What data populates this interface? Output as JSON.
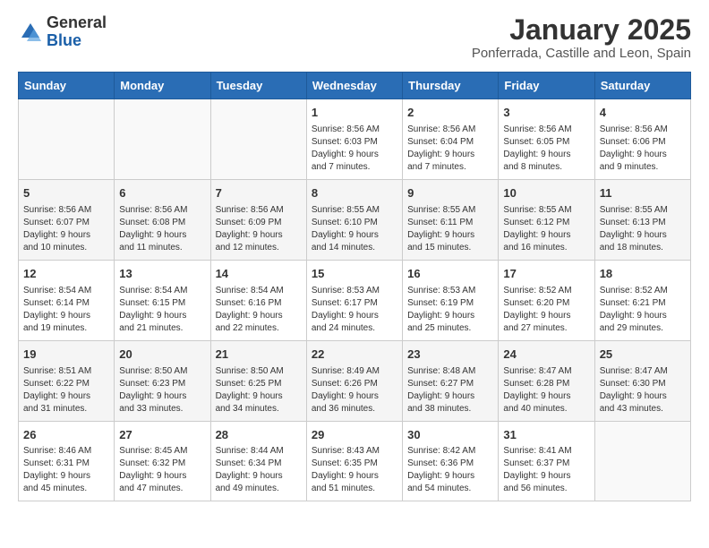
{
  "logo": {
    "general": "General",
    "blue": "Blue"
  },
  "title": "January 2025",
  "subtitle": "Ponferrada, Castille and Leon, Spain",
  "headers": [
    "Sunday",
    "Monday",
    "Tuesday",
    "Wednesday",
    "Thursday",
    "Friday",
    "Saturday"
  ],
  "weeks": [
    [
      {
        "day": "",
        "info": ""
      },
      {
        "day": "",
        "info": ""
      },
      {
        "day": "",
        "info": ""
      },
      {
        "day": "1",
        "info": "Sunrise: 8:56 AM\nSunset: 6:03 PM\nDaylight: 9 hours\nand 7 minutes."
      },
      {
        "day": "2",
        "info": "Sunrise: 8:56 AM\nSunset: 6:04 PM\nDaylight: 9 hours\nand 7 minutes."
      },
      {
        "day": "3",
        "info": "Sunrise: 8:56 AM\nSunset: 6:05 PM\nDaylight: 9 hours\nand 8 minutes."
      },
      {
        "day": "4",
        "info": "Sunrise: 8:56 AM\nSunset: 6:06 PM\nDaylight: 9 hours\nand 9 minutes."
      }
    ],
    [
      {
        "day": "5",
        "info": "Sunrise: 8:56 AM\nSunset: 6:07 PM\nDaylight: 9 hours\nand 10 minutes."
      },
      {
        "day": "6",
        "info": "Sunrise: 8:56 AM\nSunset: 6:08 PM\nDaylight: 9 hours\nand 11 minutes."
      },
      {
        "day": "7",
        "info": "Sunrise: 8:56 AM\nSunset: 6:09 PM\nDaylight: 9 hours\nand 12 minutes."
      },
      {
        "day": "8",
        "info": "Sunrise: 8:55 AM\nSunset: 6:10 PM\nDaylight: 9 hours\nand 14 minutes."
      },
      {
        "day": "9",
        "info": "Sunrise: 8:55 AM\nSunset: 6:11 PM\nDaylight: 9 hours\nand 15 minutes."
      },
      {
        "day": "10",
        "info": "Sunrise: 8:55 AM\nSunset: 6:12 PM\nDaylight: 9 hours\nand 16 minutes."
      },
      {
        "day": "11",
        "info": "Sunrise: 8:55 AM\nSunset: 6:13 PM\nDaylight: 9 hours\nand 18 minutes."
      }
    ],
    [
      {
        "day": "12",
        "info": "Sunrise: 8:54 AM\nSunset: 6:14 PM\nDaylight: 9 hours\nand 19 minutes."
      },
      {
        "day": "13",
        "info": "Sunrise: 8:54 AM\nSunset: 6:15 PM\nDaylight: 9 hours\nand 21 minutes."
      },
      {
        "day": "14",
        "info": "Sunrise: 8:54 AM\nSunset: 6:16 PM\nDaylight: 9 hours\nand 22 minutes."
      },
      {
        "day": "15",
        "info": "Sunrise: 8:53 AM\nSunset: 6:17 PM\nDaylight: 9 hours\nand 24 minutes."
      },
      {
        "day": "16",
        "info": "Sunrise: 8:53 AM\nSunset: 6:19 PM\nDaylight: 9 hours\nand 25 minutes."
      },
      {
        "day": "17",
        "info": "Sunrise: 8:52 AM\nSunset: 6:20 PM\nDaylight: 9 hours\nand 27 minutes."
      },
      {
        "day": "18",
        "info": "Sunrise: 8:52 AM\nSunset: 6:21 PM\nDaylight: 9 hours\nand 29 minutes."
      }
    ],
    [
      {
        "day": "19",
        "info": "Sunrise: 8:51 AM\nSunset: 6:22 PM\nDaylight: 9 hours\nand 31 minutes."
      },
      {
        "day": "20",
        "info": "Sunrise: 8:50 AM\nSunset: 6:23 PM\nDaylight: 9 hours\nand 33 minutes."
      },
      {
        "day": "21",
        "info": "Sunrise: 8:50 AM\nSunset: 6:25 PM\nDaylight: 9 hours\nand 34 minutes."
      },
      {
        "day": "22",
        "info": "Sunrise: 8:49 AM\nSunset: 6:26 PM\nDaylight: 9 hours\nand 36 minutes."
      },
      {
        "day": "23",
        "info": "Sunrise: 8:48 AM\nSunset: 6:27 PM\nDaylight: 9 hours\nand 38 minutes."
      },
      {
        "day": "24",
        "info": "Sunrise: 8:47 AM\nSunset: 6:28 PM\nDaylight: 9 hours\nand 40 minutes."
      },
      {
        "day": "25",
        "info": "Sunrise: 8:47 AM\nSunset: 6:30 PM\nDaylight: 9 hours\nand 43 minutes."
      }
    ],
    [
      {
        "day": "26",
        "info": "Sunrise: 8:46 AM\nSunset: 6:31 PM\nDaylight: 9 hours\nand 45 minutes."
      },
      {
        "day": "27",
        "info": "Sunrise: 8:45 AM\nSunset: 6:32 PM\nDaylight: 9 hours\nand 47 minutes."
      },
      {
        "day": "28",
        "info": "Sunrise: 8:44 AM\nSunset: 6:34 PM\nDaylight: 9 hours\nand 49 minutes."
      },
      {
        "day": "29",
        "info": "Sunrise: 8:43 AM\nSunset: 6:35 PM\nDaylight: 9 hours\nand 51 minutes."
      },
      {
        "day": "30",
        "info": "Sunrise: 8:42 AM\nSunset: 6:36 PM\nDaylight: 9 hours\nand 54 minutes."
      },
      {
        "day": "31",
        "info": "Sunrise: 8:41 AM\nSunset: 6:37 PM\nDaylight: 9 hours\nand 56 minutes."
      },
      {
        "day": "",
        "info": ""
      }
    ]
  ]
}
